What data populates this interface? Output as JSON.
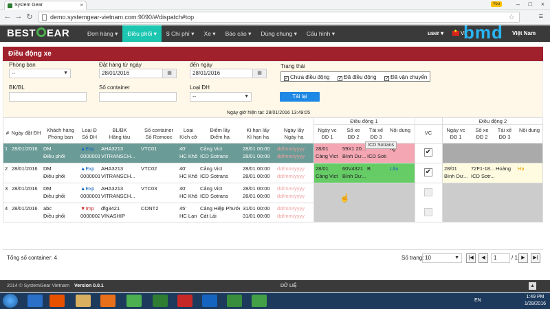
{
  "browser": {
    "tab_title": "System Gear",
    "user_badge": "You",
    "url": "demo.systemgear-vietnam.com:9090/#/dispatch#top"
  },
  "nav": {
    "logo": [
      "BEST",
      "EAR"
    ],
    "items": [
      "Đơn hàng ▾",
      "Điều phối ▾",
      "$ Chi phí ▾",
      "Xe ▾",
      "Báo cáo ▾",
      "Dùng chung ▾",
      "Cấu hình ▾"
    ],
    "active_index": 1,
    "user": "user ▾",
    "lang": "Vi",
    "lang_vn": "Việt Nam",
    "brand_watermark": "bmd"
  },
  "page": {
    "title": "Điều động xe"
  },
  "filters": {
    "phong_ban": {
      "label": "Phòng ban",
      "value": "--"
    },
    "from_date": {
      "label": "Đặt hàng từ ngày",
      "value": "28/01/2016"
    },
    "to_date": {
      "label": "đến ngày",
      "value": "28/01/2016"
    },
    "status": {
      "label": "Trạng thái",
      "options": [
        "Chưa điều động",
        "Đã điều động",
        "Đã vận chuyển"
      ]
    },
    "bk_bl": {
      "label": "BK/BL",
      "value": ""
    },
    "container": {
      "label": "Số container",
      "value": ""
    },
    "loai_dh": {
      "label": "Loại ĐH",
      "value": "--"
    },
    "reload": "Tải lại",
    "current_time": "Ngày giờ hiện tại: 28/01/2016 13:49:05"
  },
  "table": {
    "group_headers": {
      "dd1": "Điều động 1",
      "dd2": "Điều động 2"
    },
    "headers": {
      "no": "#",
      "ngay_dat": "Ngày đặt ĐH",
      "khach_hang": [
        "Khách hàng",
        "Phòng ban"
      ],
      "loai": [
        "Loại Đ",
        "Số ĐH"
      ],
      "bl": [
        "BL/BK",
        "Hãng tàu"
      ],
      "cont": [
        "Số container",
        "Số Romooc"
      ],
      "kich": [
        "Loại",
        "Kích cỡ"
      ],
      "diem_lay": [
        "Điểm lấy",
        "Điểm hạ"
      ],
      "ki_han": [
        "Kì hạn lấy",
        "Kì hạn hạ"
      ],
      "ngay_lay": [
        "Ngày lấy",
        "Ngày hạ"
      ],
      "dd1_ngay": [
        "Ngày vc",
        "ĐĐ 1"
      ],
      "dd1_soxe": [
        "Số xe",
        "ĐĐ 2"
      ],
      "dd1_taixe": [
        "Tài xế",
        "ĐĐ 3"
      ],
      "dd1_noidung": [
        "Nội dung",
        ""
      ],
      "vc": "VC",
      "dd2_ngay": [
        "Ngày vc",
        "ĐĐ 1"
      ],
      "dd2_soxe": [
        "Số xe",
        "ĐĐ 2"
      ],
      "dd2_taixe": [
        "Tài xế",
        "ĐĐ 3"
      ],
      "dd2_noidung": [
        "Nội dung",
        ""
      ]
    },
    "rows": [
      {
        "no": "1",
        "ngay": "28/01/2016",
        "kh": "DM",
        "pb": "Điều phối",
        "loai": "▲Exp",
        "so_dh": "0000001",
        "bl": "AHA3213",
        "hang": "VITRANSCH...",
        "cont": "VTC01",
        "romooc": "",
        "kich": "40'",
        "kich2": "HC Khô",
        "diem_lay": "Cảng Vict",
        "diem_ha": "ICD Sotrans",
        "kh_lay": "28/01 00:00",
        "kh_ha": "28/01 00:00",
        "nl": "dd/mm/yyyy",
        "nh": "dd/mm/yyyy",
        "d1_ngay": "28/01",
        "d1_ngay2": "Cảng Vict",
        "d1_xe": "59X1 20...",
        "d1_xe2": "Bình Dư...",
        "d1_tx": "",
        "d1_tx2": "ICD Sotr...",
        "d1_nd": "ng",
        "vc": "✔",
        "d2_ngay": "",
        "d2_ngay2": "",
        "d2_xe": "",
        "d2_xe2": "",
        "d2_tx": "",
        "d2_nd": ""
      },
      {
        "no": "2",
        "ngay": "28/01/2016",
        "kh": "DM",
        "pb": "Điều phối",
        "loai": "▲Exp",
        "so_dh": "0000001",
        "bl": "AHA3213",
        "hang": "VITRANSCH...",
        "cont": "VTC02",
        "romooc": "",
        "kich": "40'",
        "kich2": "HC Khô",
        "diem_lay": "Cảng Vict",
        "diem_ha": "ICD Sotrans",
        "kh_lay": "28/01 00:00",
        "kh_ha": "28/01 00:00",
        "nl": "dd/mm/yyyy",
        "nh": "dd/mm/yyyy",
        "d1_ngay": "28/01",
        "d1_ngay2": "Cảng Vict",
        "d1_xe": "60V4321",
        "d1_xe2": "Bình Dư...",
        "d1_tx": "B",
        "d1_tx2": "",
        "d1_nd": "Lâu",
        "vc": "✔",
        "d2_ngay": "28/01",
        "d2_ngay2": "Bình Dư...",
        "d2_xe": "72F1-18...",
        "d2_xe2": "ICD Sotr...",
        "d2_tx": "Hoàng",
        "d2_nd": "Hạ"
      },
      {
        "no": "3",
        "ngay": "28/01/2016",
        "kh": "DM",
        "pb": "Điều phối",
        "loai": "▲Exp",
        "so_dh": "0000001",
        "bl": "AHA3213",
        "hang": "VITRANSCH...",
        "cont": "VTC03",
        "romooc": "",
        "kich": "40'",
        "kich2": "HC Khô",
        "diem_lay": "Cảng Vict",
        "diem_ha": "ICD Sotrans",
        "kh_lay": "28/01 00:00",
        "kh_ha": "28/01 00:00",
        "nl": "dd/mm/yyyy",
        "nh": "dd/mm/yyyy",
        "d1_ngay": "",
        "d1_ngay2": "",
        "d1_xe": "",
        "d1_xe2": "",
        "d1_tx": "",
        "d1_tx2": "",
        "d1_nd": "",
        "vc": "",
        "d2_ngay": "",
        "d2_ngay2": "",
        "d2_xe": "",
        "d2_xe2": "",
        "d2_tx": "",
        "d2_nd": ""
      },
      {
        "no": "4",
        "ngay": "28/01/2016",
        "kh": "abc",
        "pb": "Điều phối",
        "loai": "▼Imp",
        "so_dh": "0000002",
        "bl": "dfg3421",
        "hang": "VINASHIP",
        "cont": "CONT2",
        "romooc": "",
        "kich": "45'",
        "kich2": "HC Lạn",
        "diem_lay": "Cảng Hiệp Phước",
        "diem_ha": "Cát Lái",
        "kh_lay": "31/01 00:00",
        "kh_ha": "31/01 00:00",
        "nl": "dd/mm/yyyy",
        "nh": "dd/mm/yyyy",
        "d1_ngay": "",
        "d1_ngay2": "",
        "d1_xe": "",
        "d1_xe2": "",
        "d1_tx": "",
        "d1_tx2": "",
        "d1_nd": "",
        "vc": "",
        "d2_ngay": "",
        "d2_ngay2": "",
        "d2_xe": "",
        "d2_xe2": "",
        "d2_tx": "",
        "d2_nd": ""
      }
    ],
    "tooltip": "ICD Sotrans"
  },
  "footer": {
    "total": "Tổng số container: 4",
    "page_size_label": "Số trang:",
    "page_size": "10",
    "page": "1",
    "of": "/ 1"
  },
  "version": {
    "copyright": "2014 © SystemGear Vietnam",
    "version": "Version 0.0.1",
    "data": "DỮ LIỆ"
  },
  "taskbar": {
    "lang": "EN",
    "time": "1:49 PM",
    "date": "1/28/2016"
  },
  "colors": {
    "nav_bg": "#3a3a3a",
    "nav_active": "#1cc6b0",
    "header_red": "#a0212c",
    "panel_bg": "#fff8e8",
    "reload_blue": "#1e88e5",
    "row_selected": "#6b9b96",
    "dd1_pink": "#f4a7b2",
    "dd1_green": "#66cc66"
  }
}
